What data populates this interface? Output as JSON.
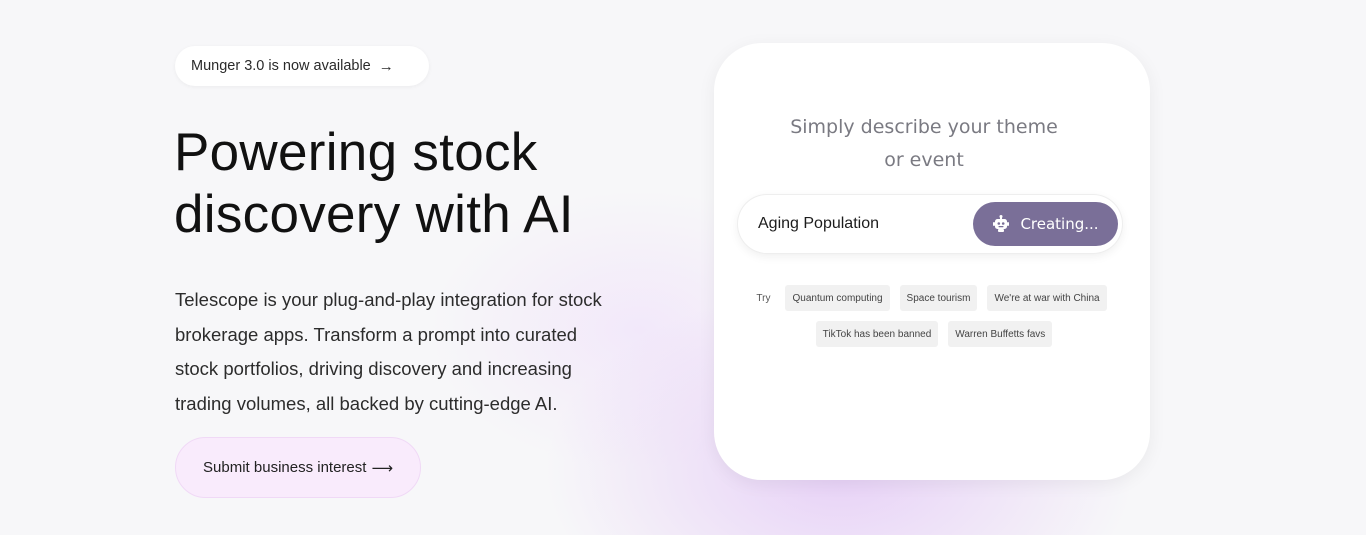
{
  "announcement": {
    "label": "Munger 3.0 is now available",
    "arrow": "→"
  },
  "hero": {
    "title_lines": [
      "Powering stock",
      "discovery with AI"
    ],
    "description_lines": [
      "Telescope is your plug-and-play integration for stock",
      "brokerage apps. Transform a prompt into curated",
      "stock portfolios, driving discovery and increasing",
      "trading volumes, all backed by cutting-edge AI."
    ],
    "cta_label": "Submit business interest",
    "cta_arrow": "⟶"
  },
  "card": {
    "title_lines": [
      "Simply describe your theme",
      "or event"
    ],
    "input_value": "Aging Population",
    "button_label": "Creating...",
    "button_icon": "robot-icon",
    "button_color": "#7a6f98",
    "try_label": "Try",
    "suggestions": [
      "Quantum computing",
      "Space tourism",
      "We're at war with China",
      "TikTok has been banned",
      "Warren Buffetts favs"
    ]
  }
}
